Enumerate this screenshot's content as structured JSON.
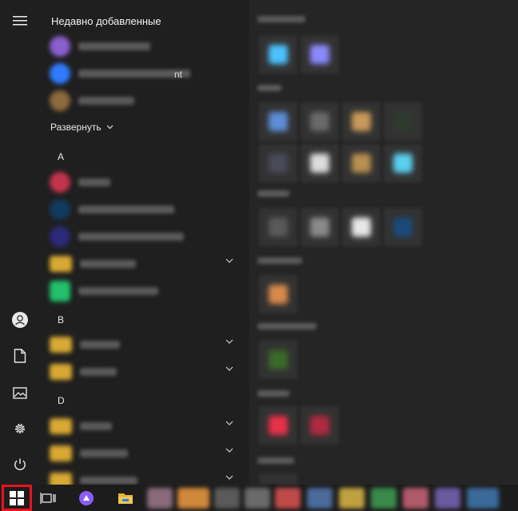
{
  "rail": {
    "items": [
      {
        "name": "menu",
        "icon": "hamburger-icon"
      },
      {
        "name": "account",
        "icon": "user-avatar-icon"
      },
      {
        "name": "documents",
        "icon": "document-icon"
      },
      {
        "name": "pictures",
        "icon": "pictures-icon"
      },
      {
        "name": "settings",
        "icon": "gear-icon"
      },
      {
        "name": "power",
        "icon": "power-icon"
      }
    ]
  },
  "applist": {
    "recently_added_title": "Недавно добавленные",
    "expand_label": "Развернуть",
    "stray_text": "nt",
    "letters": {
      "a": "A",
      "b": "B",
      "d": "D"
    }
  },
  "taskbar": {
    "start_icon": "windows-logo-icon",
    "task_view_icon": "task-view-icon",
    "alice_icon": "alice-assistant-icon",
    "explorer_icon": "file-explorer-icon",
    "colors": {
      "start_highlight": "#e8141c",
      "alice": "#8b5cf6",
      "folder": "#e8b339"
    }
  }
}
